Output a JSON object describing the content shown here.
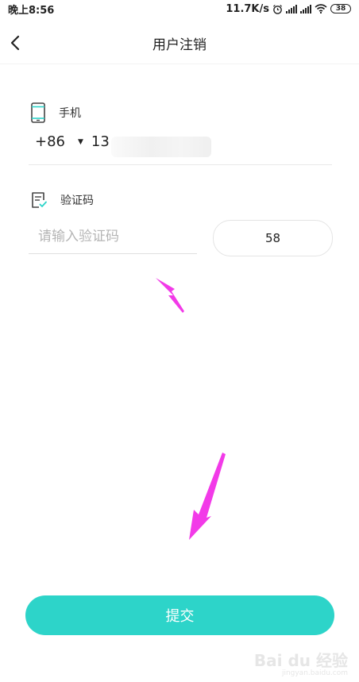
{
  "status_bar": {
    "time": "晚上8:56",
    "network_speed": "11.7K/s",
    "battery": "38"
  },
  "nav": {
    "title": "用户注销",
    "back_icon": "chevron-left-icon"
  },
  "phone": {
    "label": "手机",
    "icon": "phone-icon",
    "country_code": "+86",
    "value_visible": "13"
  },
  "verification": {
    "label": "验证码",
    "icon": "document-check-icon",
    "placeholder": "请输入验证码",
    "countdown": "58"
  },
  "submit": {
    "label": "提交"
  },
  "watermark": {
    "text": "Bai du 经验",
    "url": "jingyan.baidu.com"
  },
  "colors": {
    "accent": "#2dd4c9",
    "annotation_arrow": "#f23ae8"
  }
}
